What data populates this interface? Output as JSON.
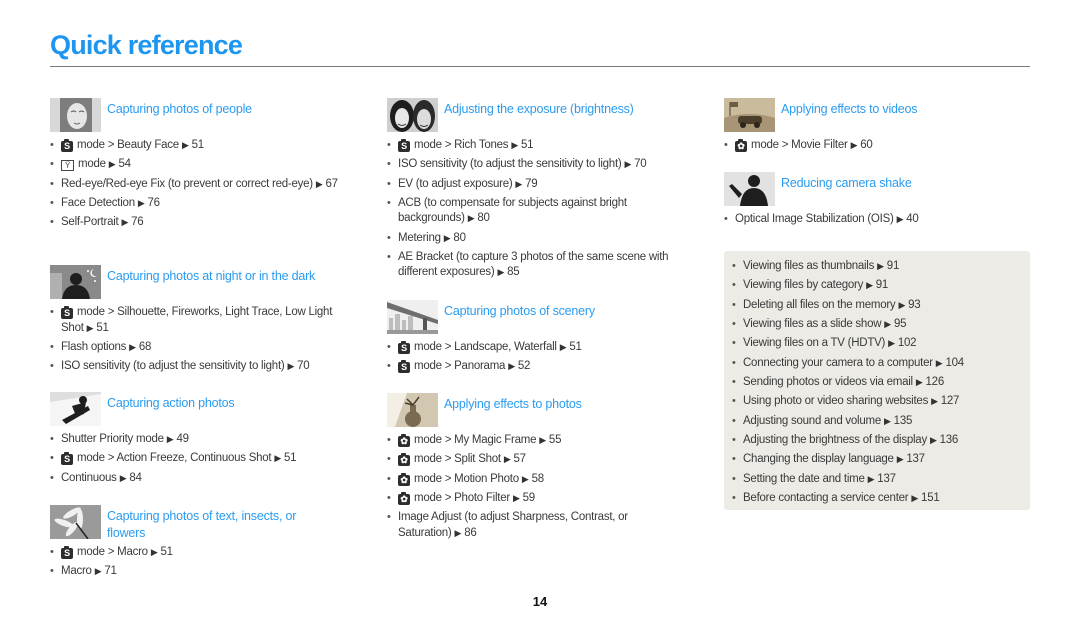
{
  "page": {
    "title": "Quick reference",
    "page_number": "14",
    "accent_color": "#1e96f0",
    "panel_color": "#edebe5"
  },
  "sections": [
    {
      "id": "people",
      "title": "Capturing photos of people",
      "thumbnail": "woman-portrait-photo",
      "items": [
        {
          "icon": "smart-mode-icon",
          "text": "mode > Beauty Face",
          "page": "51"
        },
        {
          "icon": "portrait-mode-icon",
          "text": "mode",
          "page": "54"
        },
        {
          "icon": "",
          "text": "Red-eye/Red-eye Fix (to prevent or correct red-eye)",
          "page": "67"
        },
        {
          "icon": "",
          "text": "Face Detection",
          "page": "76"
        },
        {
          "icon": "",
          "text": "Self-Portrait",
          "page": "76"
        }
      ]
    },
    {
      "id": "night",
      "title": "Capturing photos at night or in the dark",
      "thumbnail": "night-silhouette-photo",
      "items": [
        {
          "icon": "smart-mode-icon",
          "text": "mode > Silhouette, Fireworks, Light Trace, Low Light Shot",
          "page": "51"
        },
        {
          "icon": "",
          "text": "Flash options",
          "page": "68"
        },
        {
          "icon": "",
          "text": "ISO sensitivity (to adjust the sensitivity to light)",
          "page": "70"
        }
      ]
    },
    {
      "id": "action",
      "title": "Capturing action photos",
      "thumbnail": "snowboarder-photo",
      "items": [
        {
          "icon": "",
          "text": "Shutter Priority mode",
          "page": "49"
        },
        {
          "icon": "smart-mode-icon",
          "text": "mode > Action Freeze, Continuous Shot",
          "page": "51"
        },
        {
          "icon": "",
          "text": "Continuous",
          "page": "84"
        }
      ]
    },
    {
      "id": "macro",
      "title": "Capturing photos of text, insects, or flowers",
      "thumbnail": "flower-photo",
      "items": [
        {
          "icon": "smart-mode-icon",
          "text": "mode > Macro",
          "page": "51"
        },
        {
          "icon": "",
          "text": "Macro",
          "page": "71"
        }
      ]
    },
    {
      "id": "exposure",
      "title": "Adjusting the exposure (brightness)",
      "thumbnail": "two-faces-photo",
      "items": [
        {
          "icon": "smart-mode-icon",
          "text": "mode > Rich Tones",
          "page": "51"
        },
        {
          "icon": "",
          "text": "ISO sensitivity (to adjust the sensitivity to light)",
          "page": "70"
        },
        {
          "icon": "",
          "text": "EV (to adjust exposure)",
          "page": "79"
        },
        {
          "icon": "",
          "text": "ACB (to compensate for subjects against bright backgrounds)",
          "page": "80"
        },
        {
          "icon": "",
          "text": "Metering",
          "page": "80"
        },
        {
          "icon": "",
          "text": "AE Bracket (to capture 3 photos of the same scene with different exposures)",
          "page": "85"
        }
      ]
    },
    {
      "id": "scenery",
      "title": "Capturing photos of scenery",
      "thumbnail": "bridge-photo",
      "items": [
        {
          "icon": "smart-mode-icon",
          "text": "mode > Landscape, Waterfall",
          "page": "51"
        },
        {
          "icon": "smart-mode-icon",
          "text": "mode > Panorama",
          "page": "52"
        }
      ]
    },
    {
      "id": "photo-effects",
      "title": "Applying effects to photos",
      "thumbnail": "vase-photo",
      "items": [
        {
          "icon": "magic-mode-icon",
          "text": "mode > My Magic Frame",
          "page": "55"
        },
        {
          "icon": "magic-mode-icon",
          "text": "mode > Split Shot",
          "page": "57"
        },
        {
          "icon": "magic-mode-icon",
          "text": "mode > Motion Photo",
          "page": "58"
        },
        {
          "icon": "magic-mode-icon",
          "text": "mode > Photo Filter",
          "page": "59"
        },
        {
          "icon": "",
          "text": "Image Adjust (to adjust Sharpness, Contrast, or Saturation)",
          "page": "86"
        }
      ]
    },
    {
      "id": "video-effects",
      "title": "Applying effects to videos",
      "thumbnail": "car-sepia-photo",
      "items": [
        {
          "icon": "magic-mode-icon",
          "text": "mode > Movie Filter",
          "page": "60"
        }
      ]
    },
    {
      "id": "shake",
      "title": "Reducing camera shake",
      "thumbnail": "waving-silhouette-photo",
      "items": [
        {
          "icon": "",
          "text": "Optical Image Stabilization (OIS)",
          "page": "40"
        }
      ]
    }
  ],
  "panel": {
    "items": [
      {
        "text": "Viewing files as thumbnails",
        "page": "91"
      },
      {
        "text": "Viewing files by category",
        "page": "91"
      },
      {
        "text": "Deleting all files on the memory",
        "page": "93"
      },
      {
        "text": "Viewing files as a slide show",
        "page": "95"
      },
      {
        "text": "Viewing files on a TV (HDTV)",
        "page": "102"
      },
      {
        "text": "Connecting your camera to a computer",
        "page": "104"
      },
      {
        "text": "Sending photos or videos via email",
        "page": "126"
      },
      {
        "text": "Using photo or video sharing websites",
        "page": "127"
      },
      {
        "text": "Adjusting sound and volume",
        "page": "135"
      },
      {
        "text": "Adjusting the brightness of the display",
        "page": "136"
      },
      {
        "text": "Changing the display language",
        "page": "137"
      },
      {
        "text": "Setting the date and time",
        "page": "137"
      },
      {
        "text": "Before contacting a service center",
        "page": "151"
      }
    ]
  },
  "glyphs": {
    "arrow": "▶",
    "smart_mode_letter": "S",
    "magic_mode_symbol": "✿",
    "portrait_symbol": "Ϋ"
  }
}
